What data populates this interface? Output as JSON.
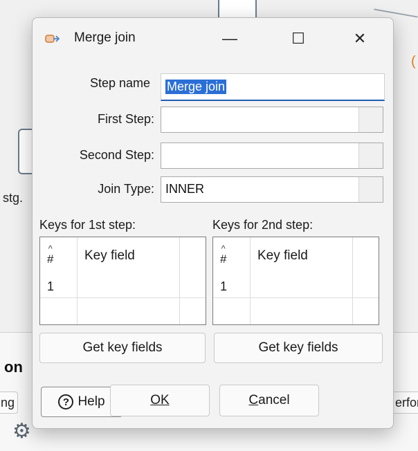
{
  "background": {
    "left_label": "stg.",
    "section_heading": "on",
    "tab_left": "ng",
    "tab_right": "erfor",
    "gear_icon": "gear-icon"
  },
  "dialog": {
    "title": "Merge join",
    "title_icon": "merge-join-icon",
    "window_controls": {
      "minimize": "—",
      "maximize": "☐",
      "close": "✕"
    },
    "fields": {
      "step_name_label": "Step name",
      "step_name_value": "Merge join",
      "first_step_label": "First Step:",
      "first_step_value": "",
      "second_step_label": "Second Step:",
      "second_step_value": "",
      "join_type_label": "Join Type:",
      "join_type_value": "INNER"
    },
    "keys1": {
      "label": "Keys for 1st step:",
      "col_num": "#",
      "col_key": "Key field",
      "rows": [
        "1"
      ]
    },
    "keys2": {
      "label": "Keys for 2nd step:",
      "col_num": "#",
      "col_key": "Key field",
      "rows": [
        "1"
      ]
    },
    "get_key_fields_1": "Get key fields",
    "get_key_fields_2": "Get key fields",
    "help_label": "Help",
    "ok_label": "OK",
    "cancel_label": "Cancel"
  },
  "colors": {
    "accent": "#1e5fb4",
    "selection": "#2b6fd6",
    "background_orange": "#e07b1a"
  }
}
